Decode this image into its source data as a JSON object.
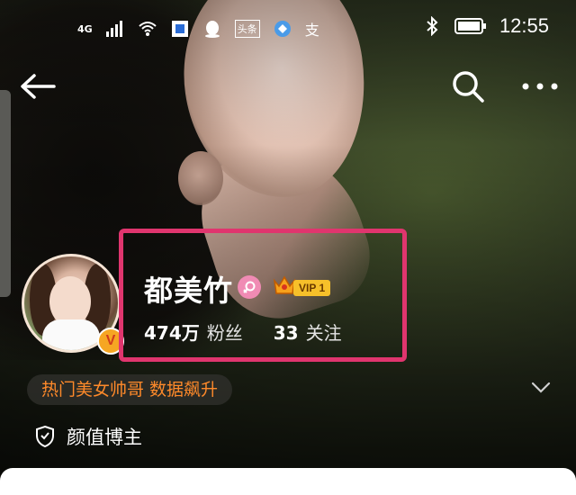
{
  "status_bar": {
    "network": "4G",
    "app_icons": [
      "signal-icon",
      "wifi-icon",
      "app-icon",
      "qq-icon",
      "toutiao-icon",
      "browser-icon",
      "alipay-icon"
    ],
    "toutiao_label": "头条",
    "alipay_label": "支",
    "time": "12:55"
  },
  "profile": {
    "name": "都美竹",
    "gender": "female",
    "vip_label": "VIP 1",
    "followers_value": "474万",
    "followers_label": "粉丝",
    "following_value": "33",
    "following_label": "关注"
  },
  "tag_text": "热门美女帅哥 数据飙升",
  "verification": "颜值博主",
  "colors": {
    "highlight_border": "#e0356e",
    "tag_text": "#ff8a2a",
    "vip_bg": "#f7c02a",
    "female_badge": "#f08bb4"
  }
}
